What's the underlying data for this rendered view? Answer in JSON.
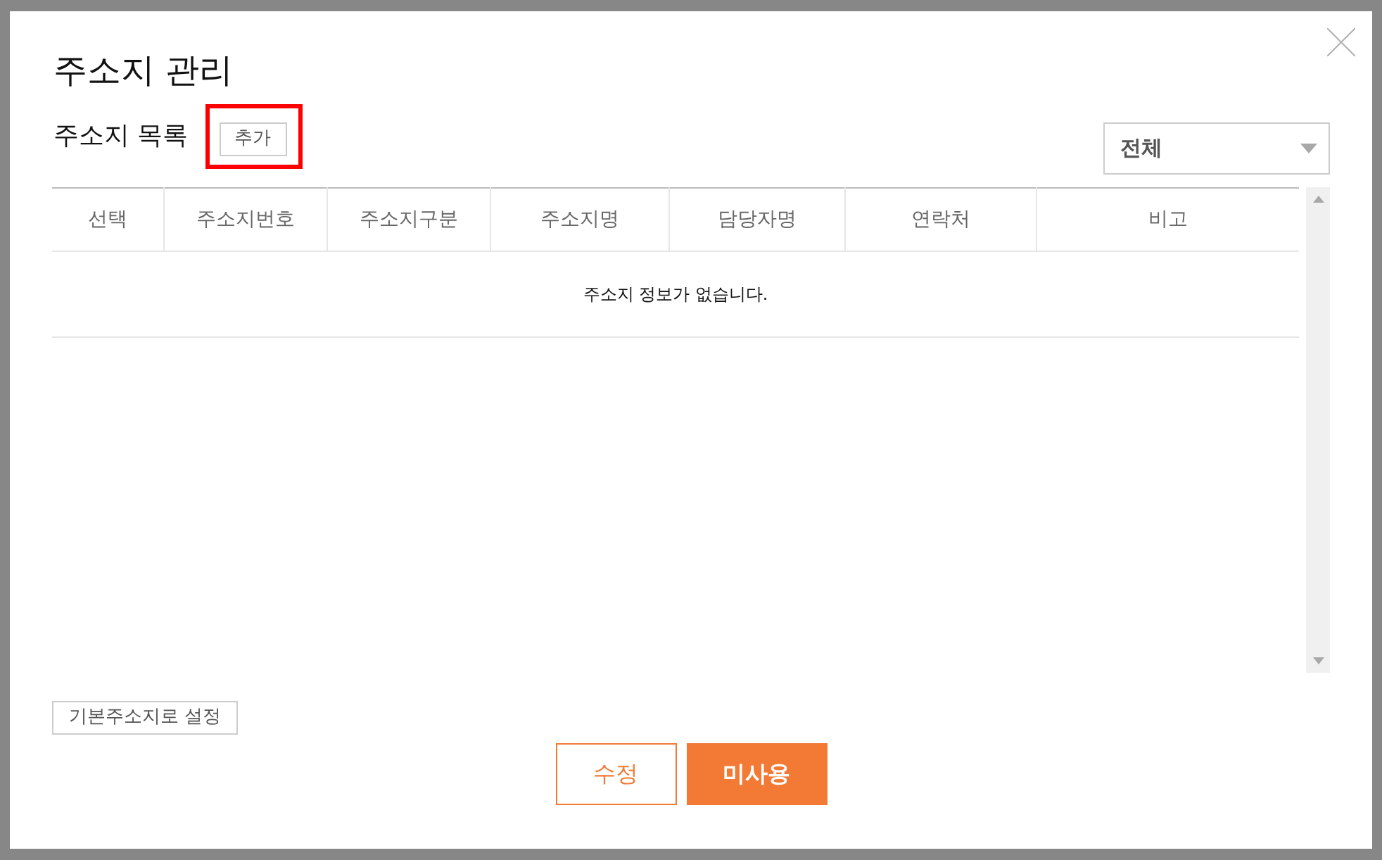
{
  "dialog": {
    "title": "주소지 관리"
  },
  "list": {
    "heading": "주소지 목록",
    "add_button": {
      "label": "추가",
      "highlighted": true
    }
  },
  "filter": {
    "value": "전체"
  },
  "table": {
    "columns": [
      "선택",
      "주소지번호",
      "주소지구분",
      "주소지명",
      "담당자명",
      "연락처",
      "비고"
    ],
    "empty_message": "주소지 정보가 없습니다."
  },
  "set_default_button": {
    "label": "기본주소지로 설정"
  },
  "buttons": [
    {
      "label": "수정",
      "kind": "outline"
    },
    {
      "label": "미사용",
      "kind": "primary"
    }
  ]
}
